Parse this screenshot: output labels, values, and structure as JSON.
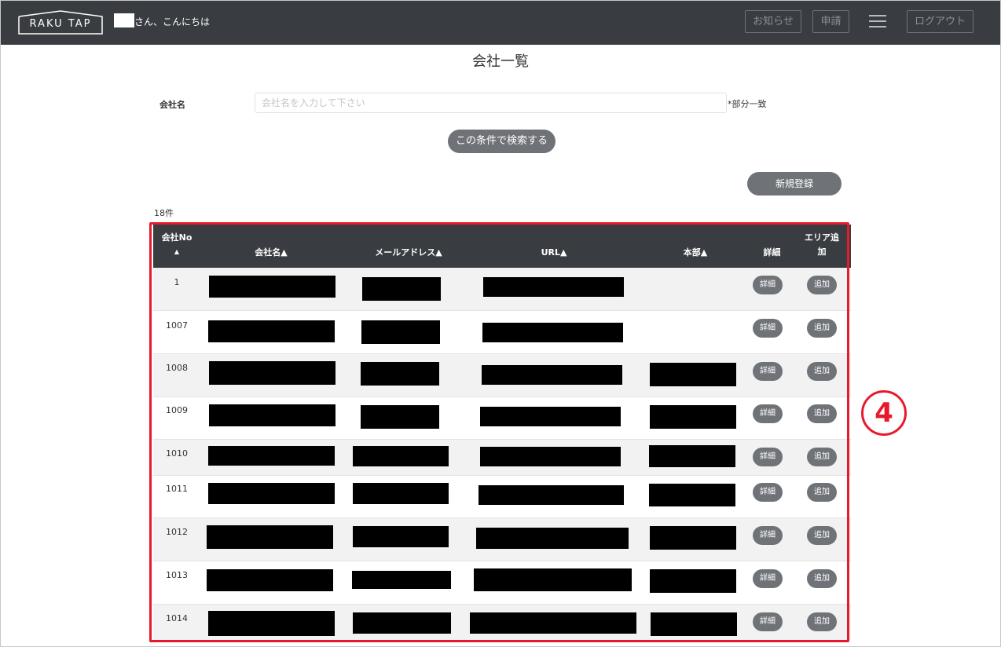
{
  "header": {
    "logo_text": "RAKU TAP",
    "greeting": "さん、こんにちは",
    "notice_label": "お知らせ",
    "apply_label": "申請",
    "logout_label": "ログアウト"
  },
  "page": {
    "title": "会社一覧",
    "company_name_label": "会社名",
    "search_placeholder": "会社名を入力して下さい",
    "search_value": "",
    "partial_note": "*部分一致",
    "search_button": "この条件で検索する",
    "new_button": "新規登録",
    "count": "18件"
  },
  "table": {
    "headers": {
      "no_line1": "会社No",
      "no_line2": "▲",
      "name": "会社名▲",
      "email": "メールアドレス▲",
      "url": "URL▲",
      "hq": "本部▲",
      "detail": "詳細",
      "area_line1": "エリア追",
      "area_line2": "加"
    },
    "detail_label": "詳細",
    "add_label": "追加",
    "rows": [
      {
        "no": "1"
      },
      {
        "no": "1007"
      },
      {
        "no": "1008"
      },
      {
        "no": "1009"
      },
      {
        "no": "1010"
      },
      {
        "no": "1011"
      },
      {
        "no": "1012"
      },
      {
        "no": "1013"
      },
      {
        "no": "1014"
      }
    ]
  },
  "annotation": {
    "number": "4",
    "color": "#e8192c"
  },
  "colors": {
    "header_bg": "#393c41",
    "button_bg": "#6f7378"
  }
}
